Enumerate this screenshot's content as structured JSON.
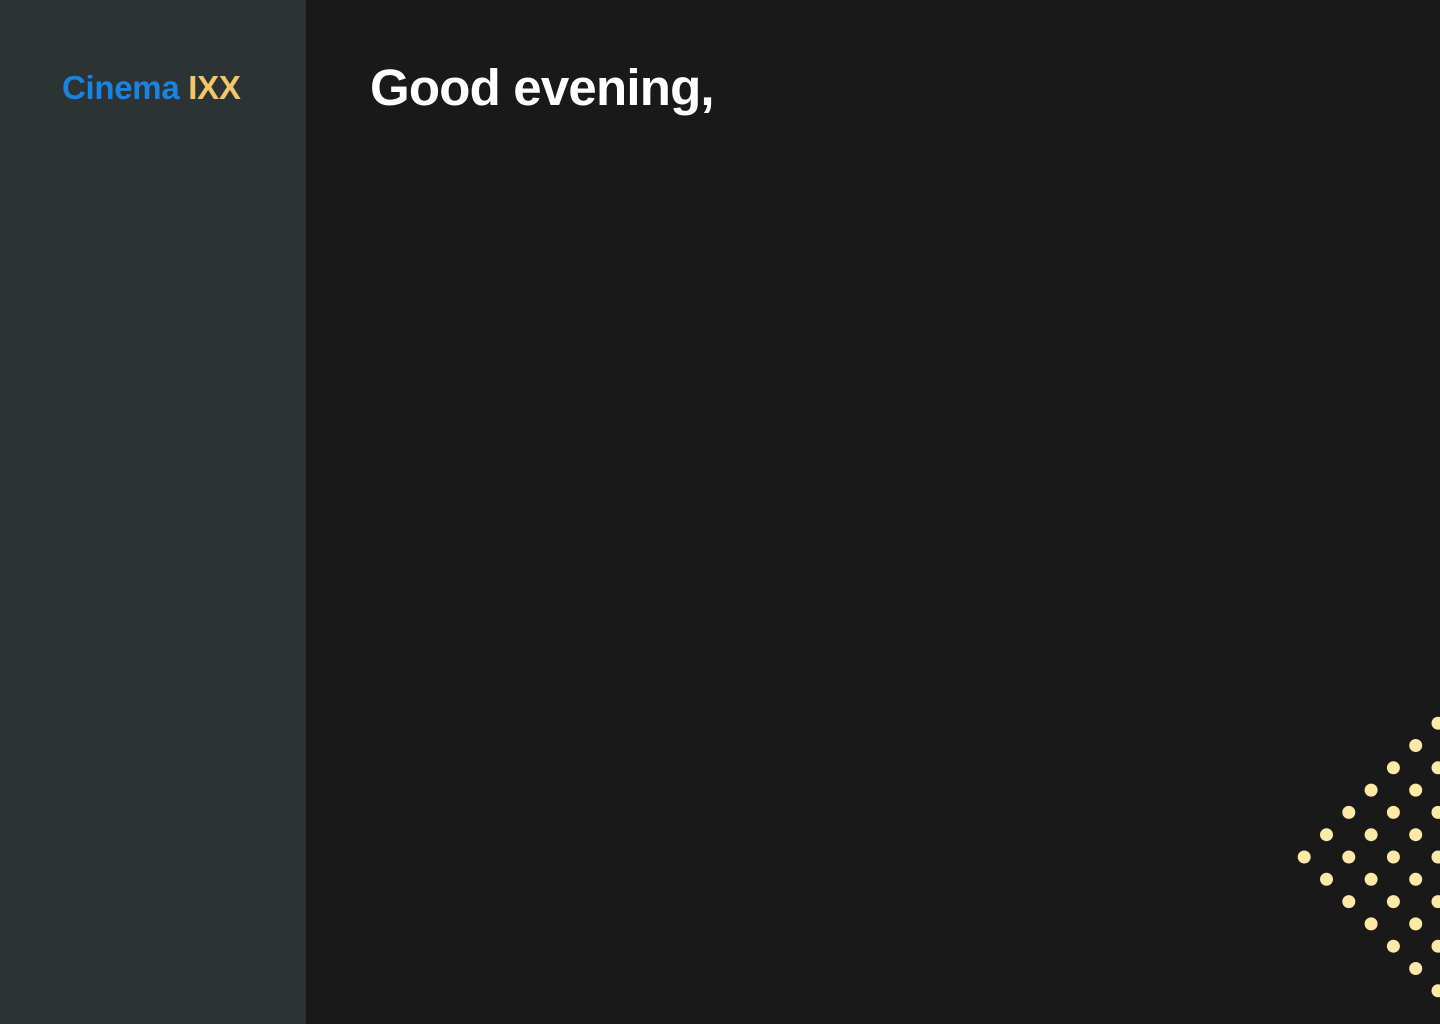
{
  "sidebar": {
    "logo": {
      "part1": "Cinema",
      "part2": "IXX"
    }
  },
  "main": {
    "greeting": "Good evening,"
  },
  "colors": {
    "sidebar_bg": "#2c3335",
    "main_bg": "#191919",
    "logo_primary": "#1a83df",
    "logo_accent": "#f2c76b",
    "greeting_text": "#ffffff",
    "dot_color": "#fde9a6"
  }
}
